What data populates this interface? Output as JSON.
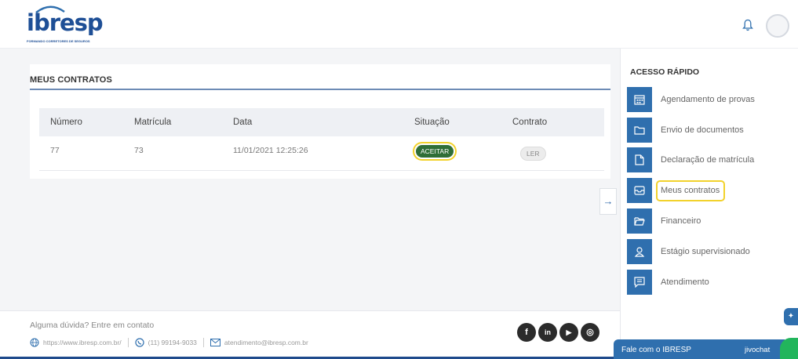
{
  "brand": {
    "name": "ibresp",
    "tagline": "FORMANDO CORRETORES DE SEGUROS"
  },
  "colors": {
    "primary": "#2f6fae",
    "accept_green": "#2f6e37",
    "highlight": "#f2d22c",
    "chat_green": "#22b55c"
  },
  "contracts": {
    "title": "MEUS CONTRATOS",
    "columns": [
      "Número",
      "Matrícula",
      "Data",
      "Situação",
      "Contrato"
    ],
    "rows": [
      {
        "numero": "77",
        "matricula": "73",
        "data": "11/01/2021 12:25:26",
        "situacao_button": "ACEITAR",
        "contrato_button": "LER"
      }
    ]
  },
  "quick_access": {
    "title": "ACESSO RÁPIDO",
    "items": [
      {
        "label": "Agendamento de provas",
        "icon": "calendar-icon"
      },
      {
        "label": "Envio de documentos",
        "icon": "folder-icon"
      },
      {
        "label": "Declaração de matrícula",
        "icon": "document-icon"
      },
      {
        "label": "Meus contratos",
        "icon": "inbox-icon"
      },
      {
        "label": "Financeiro",
        "icon": "folder-open-icon"
      },
      {
        "label": "Estágio supervisionado",
        "icon": "user-icon"
      },
      {
        "label": "Atendimento",
        "icon": "chat-icon"
      }
    ]
  },
  "footer": {
    "question": "Alguma dúvida? Entre em contato",
    "website": "https://www.ibresp.com.br/",
    "phone": "(11) 99194-9033",
    "email": "atendimento@ibresp.com.br",
    "social": [
      "f",
      "in",
      "▶",
      "◎"
    ]
  },
  "chat": {
    "label": "Fale com o IBRESP",
    "brand": "jivochat"
  }
}
